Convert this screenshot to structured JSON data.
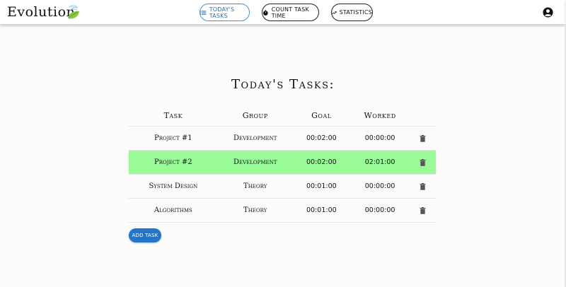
{
  "app": {
    "brand": "Evolution"
  },
  "nav": {
    "today_label": "TODAY'S TASKS",
    "count_label": "COUNT TASK TIME",
    "stats_label": "STATISTICS"
  },
  "colors": {
    "accent_active": "#2f6fa8",
    "row_highlight": "#98fb98",
    "add_button": "#2176c9"
  },
  "page": {
    "title": "Today's Tasks:"
  },
  "table": {
    "headers": [
      "Task",
      "Group",
      "Goal",
      "Worked"
    ],
    "rows": [
      {
        "task": "Project #1",
        "group": "Development",
        "goal": "00:02:00",
        "worked": "00:00:00",
        "highlight": false
      },
      {
        "task": "Project #2",
        "group": "Development",
        "goal": "00:02:00",
        "worked": "02:01:00",
        "highlight": true
      },
      {
        "task": "System Design",
        "group": "Theory",
        "goal": "00:01:00",
        "worked": "00:00:00",
        "highlight": false
      },
      {
        "task": "Algorithms",
        "group": "Theory",
        "goal": "00:01:00",
        "worked": "00:00:00",
        "highlight": false
      }
    ]
  },
  "actions": {
    "add_task_label": "ADD TASK"
  },
  "icons": {
    "brand": "leaf-logo-icon",
    "today": "list-icon",
    "count": "stopwatch-icon",
    "stats": "trend-chart-icon",
    "account": "account-circle-icon",
    "delete": "trash-icon"
  }
}
